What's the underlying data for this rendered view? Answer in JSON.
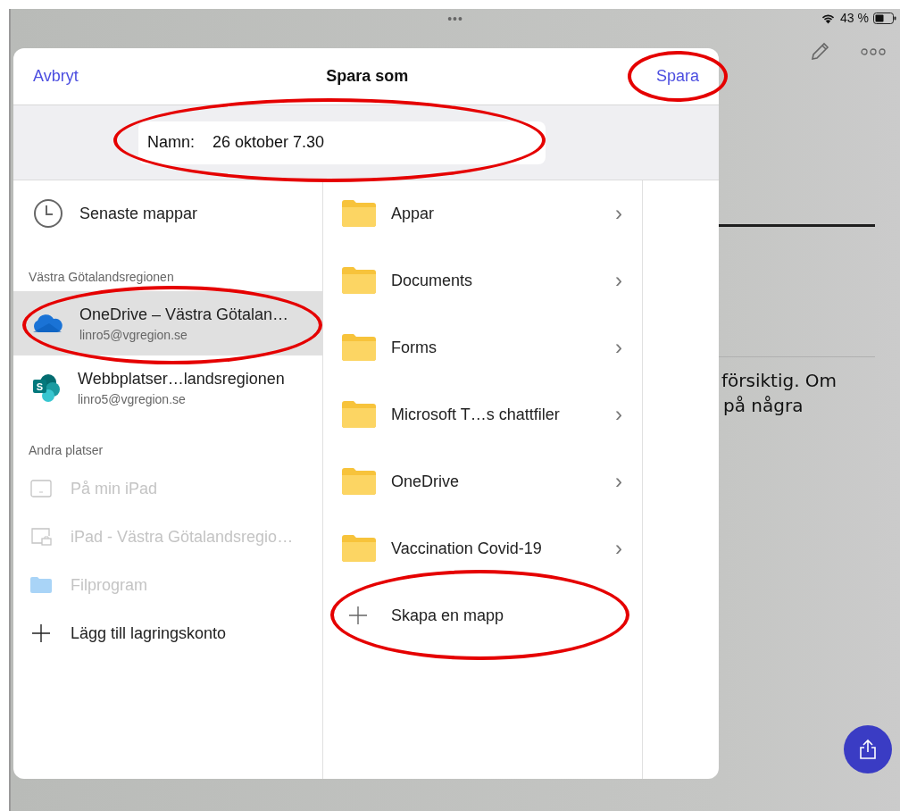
{
  "status_bar": {
    "dots": "•••",
    "battery": "43 %"
  },
  "background_document": {
    "lines": [
      "försiktig. Om",
      "på några"
    ]
  },
  "dialog": {
    "title": "Spara som",
    "cancel": {
      "label": "Avbryt",
      "highlighted": false
    },
    "save": {
      "label": "Spara",
      "highlighted": true
    },
    "name_field": {
      "label": "Namn:",
      "value": "26 oktober 7.30",
      "highlighted": true
    },
    "sidebar": [
      {
        "kind": "recent",
        "title": "Senaste mappar",
        "selected": false,
        "highlighted": false
      },
      {
        "kind": "header",
        "title": "Västra Götalandsregionen"
      },
      {
        "kind": "onedrive",
        "title": "OneDrive – Västra Götalan…",
        "subtitle": "linro5@vgregion.se",
        "selected": true,
        "highlighted": true
      },
      {
        "kind": "sharepoint",
        "logo_letter": "S",
        "title": "Webbplatser…landsregionen",
        "subtitle": "linro5@vgregion.se",
        "selected": false,
        "highlighted": false
      },
      {
        "kind": "header",
        "title": "Andra platser"
      },
      {
        "kind": "device",
        "title": "På min iPad",
        "disabled": true
      },
      {
        "kind": "device-work",
        "title": "iPad - Västra Götalandsregio…",
        "disabled": true
      },
      {
        "kind": "files",
        "title": "Filprogram",
        "disabled": true
      },
      {
        "kind": "add",
        "title": "Lägg till lagringskonto",
        "disabled": false
      }
    ],
    "folders": [
      {
        "kind": "folder",
        "title": "Appar",
        "chevron": "›"
      },
      {
        "kind": "folder",
        "title": "Documents",
        "chevron": "›"
      },
      {
        "kind": "folder",
        "title": "Forms",
        "chevron": "›"
      },
      {
        "kind": "folder",
        "title": "Microsoft T…s chattfiler",
        "chevron": "›"
      },
      {
        "kind": "folder",
        "title": "OneDrive",
        "chevron": "›"
      },
      {
        "kind": "folder",
        "title": "Vaccination Covid-19",
        "chevron": "›"
      },
      {
        "kind": "new",
        "title": "Skapa en mapp",
        "highlighted": true
      }
    ]
  }
}
